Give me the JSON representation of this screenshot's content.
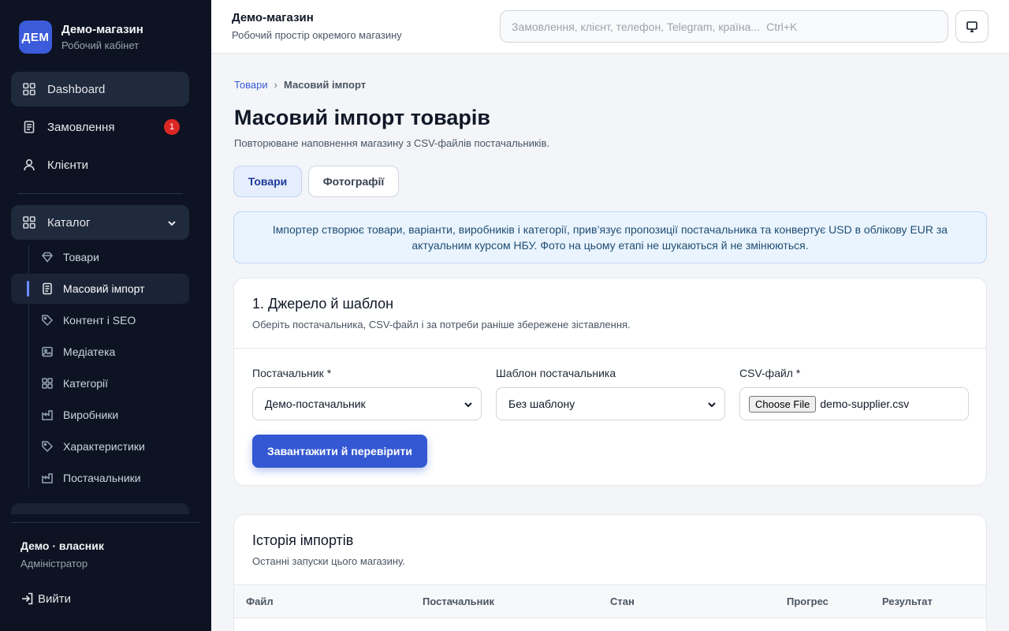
{
  "sidebar": {
    "brand": {
      "logo": "ДЕМ",
      "title": "Демо-магазин",
      "subtitle": "Робочий кабінет"
    },
    "items": [
      {
        "label": "Dashboard",
        "icon": "grid-icon"
      },
      {
        "label": "Замовлення",
        "icon": "document-icon",
        "badge": "1"
      },
      {
        "label": "Клієнти",
        "icon": "user-icon"
      },
      {
        "label": "Каталог",
        "icon": "grid-icon",
        "expanded": true
      }
    ],
    "catalog_items": [
      {
        "label": "Товари",
        "icon": "diamond-icon"
      },
      {
        "label": "Масовий імпорт",
        "icon": "document-icon",
        "active": true
      },
      {
        "label": "Контент і SEO",
        "icon": "tag-icon"
      },
      {
        "label": "Медіатека",
        "icon": "image-icon"
      },
      {
        "label": "Категорії",
        "icon": "grid-icon"
      },
      {
        "label": "Виробники",
        "icon": "factory-icon"
      },
      {
        "label": "Характеристики",
        "icon": "tag-icon"
      },
      {
        "label": "Постачальники",
        "icon": "factory-icon"
      }
    ],
    "user": {
      "name": "Демо · власник",
      "role": "Адміністратор"
    },
    "logout_label": "Вийти"
  },
  "topbar": {
    "title": "Демо-магазин",
    "subtitle": "Робочий простір окремого магазину",
    "search_placeholder": "Замовлення, клієнт, телефон, Telegram, країна...",
    "search_shortcut": "Ctrl+K"
  },
  "breadcrumb": {
    "parent": "Товари",
    "separator": "›",
    "current": "Масовий імпорт"
  },
  "page": {
    "title": "Масовий імпорт товарів",
    "subtitle": "Повторюване наповнення магазину з CSV-файлів постачальників."
  },
  "tabs": [
    {
      "label": "Товари",
      "active": true
    },
    {
      "label": "Фотографії",
      "active": false
    }
  ],
  "info_text": "Імпортер створює товари, варіанти, виробників і категорії, прив’язує пропозиції постачальника та конвертує USD в облікову EUR за актуальним курсом НБУ. Фото на цьому етапі не шукаються й не змінюються.",
  "source_card": {
    "title": "1. Джерело й шаблон",
    "subtitle": "Оберіть постачальника, CSV-файл і за потреби раніше збережене зіставлення.",
    "supplier": {
      "label": "Постачальник *",
      "value": "Демо-постачальник"
    },
    "template": {
      "label": "Шаблон постачальника",
      "value": "Без шаблону"
    },
    "csv": {
      "label": "CSV-файл *",
      "button": "Choose File",
      "filename": "demo-supplier.csv"
    },
    "submit_label": "Завантажити й перевірити"
  },
  "history_card": {
    "title": "Історія імпортів",
    "subtitle": "Останні запуски цього магазину.",
    "columns": [
      "Файл",
      "Постачальник",
      "Стан",
      "Прогрес",
      "Результат"
    ]
  },
  "colors": {
    "accent": "#3458d3",
    "sidebar_bg": "#0d1322",
    "badge": "#dc2626"
  }
}
